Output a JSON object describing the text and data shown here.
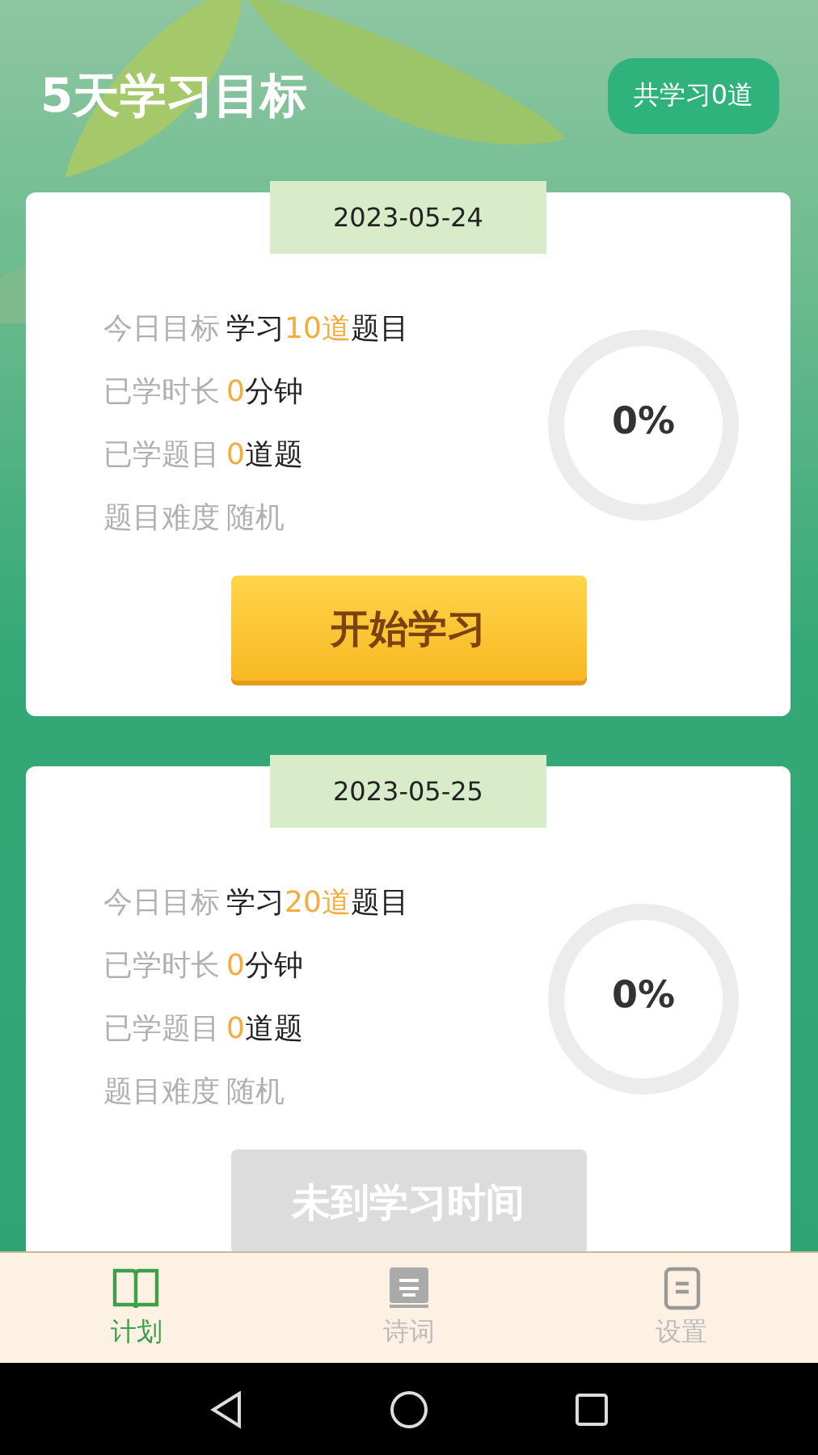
{
  "header": {
    "title": "5天学习目标",
    "total_badge": "共学习0道"
  },
  "plans": [
    {
      "date": "2023-05-24",
      "rows": [
        {
          "label": "今日目标",
          "muted": false,
          "value": [
            {
              "text": "学习",
              "highlight": false
            },
            {
              "text": "10道",
              "highlight": true
            },
            {
              "text": "题目",
              "highlight": false
            }
          ]
        },
        {
          "label": "已学时长",
          "muted": false,
          "value": [
            {
              "text": "0",
              "highlight": true
            },
            {
              "text": "分钟",
              "highlight": false
            }
          ]
        },
        {
          "label": "已学题目",
          "muted": false,
          "value": [
            {
              "text": "0",
              "highlight": true
            },
            {
              "text": "道题",
              "highlight": false
            }
          ]
        },
        {
          "label": "题目难度",
          "muted": true,
          "value": [
            {
              "text": "随机",
              "highlight": false
            }
          ]
        }
      ],
      "progress": {
        "reading": "0%"
      },
      "button": {
        "label": "开始学习",
        "disabled": false
      }
    },
    {
      "date": "2023-05-25",
      "rows": [
        {
          "label": "今日目标",
          "muted": false,
          "value": [
            {
              "text": "学习",
              "highlight": false
            },
            {
              "text": "20道",
              "highlight": true
            },
            {
              "text": "题目",
              "highlight": false
            }
          ]
        },
        {
          "label": "已学时长",
          "muted": false,
          "value": [
            {
              "text": "0",
              "highlight": true
            },
            {
              "text": "分钟",
              "highlight": false
            }
          ]
        },
        {
          "label": "已学题目",
          "muted": false,
          "value": [
            {
              "text": "0",
              "highlight": true
            },
            {
              "text": "道题",
              "highlight": false
            }
          ]
        },
        {
          "label": "题目难度",
          "muted": true,
          "value": [
            {
              "text": "随机",
              "highlight": false
            }
          ]
        }
      ],
      "progress": {
        "reading": "0%"
      },
      "button": {
        "label": "未到学习时间",
        "disabled": true
      }
    }
  ],
  "tab_bar": [
    {
      "label": "计划",
      "selected": true
    },
    {
      "label": "诗词",
      "selected": false
    },
    {
      "label": "设置",
      "selected": false
    }
  ]
}
